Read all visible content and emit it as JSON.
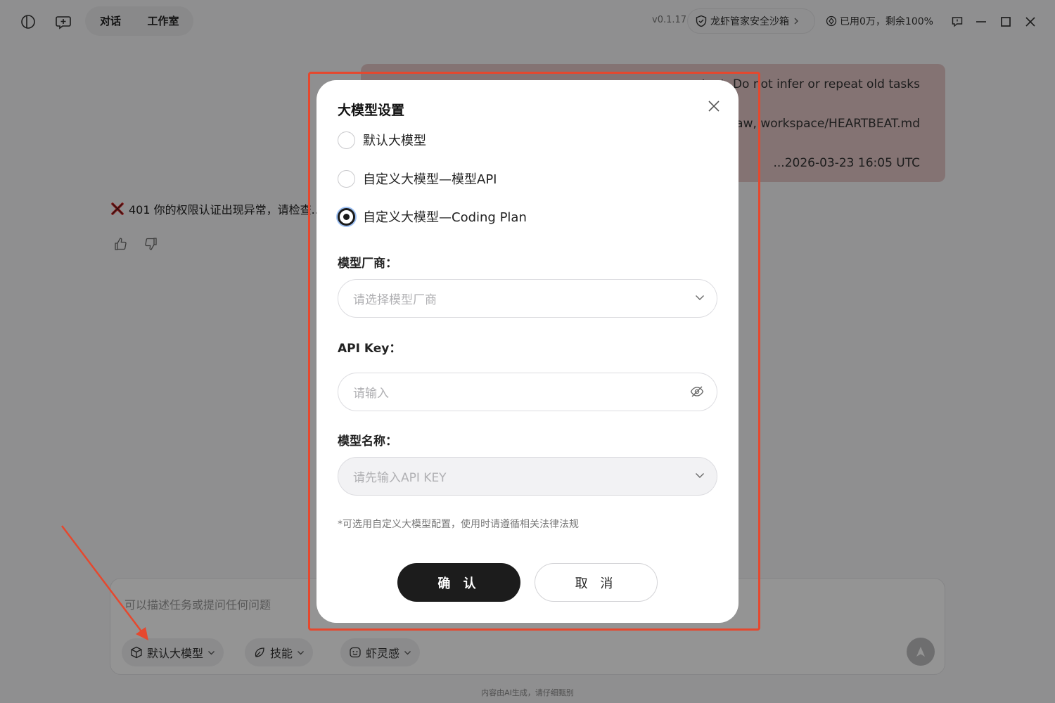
{
  "topbar": {
    "tabs": [
      "对话",
      "工作室"
    ],
    "version": "v0.1.17",
    "sandbox_label": "龙虾管家安全沙箱",
    "quota_label": "已用0万，剩余100%"
  },
  "chat": {
    "user_message": [
      "...ntext. Do not infer or repeat old tasks",
      "...law, workspace/HEARTBEAT.md",
      "...2026-03-23 16:05 UTC"
    ],
    "error_message": "401 你的权限认证出现异常，请检查..."
  },
  "composer": {
    "placeholder": "可以描述任务或提问任何问题",
    "model_chip": "默认大模型",
    "skills_chip": "技能",
    "inspire_chip": "虾灵感"
  },
  "footer": "内容由AI生成，请仔细甄别",
  "dialog": {
    "title": "大模型设置",
    "options": [
      "默认大模型",
      "自定义大模型—模型API",
      "自定义大模型—Coding Plan"
    ],
    "selected_option": "自定义大模型—Coding Plan",
    "vendor_label": "模型厂商：",
    "vendor_placeholder": "请选择模型厂商",
    "apikey_label": "API Key：",
    "apikey_placeholder": "请输入",
    "model_name_label": "模型名称：",
    "model_name_placeholder": "请先输入API KEY",
    "hint": "*可选用自定义大模型配置，使用时请遵循相关法律法规",
    "confirm": "确 认",
    "cancel": "取 消"
  },
  "colors": {
    "highlight_border": "#e5482e",
    "primary_button": "#1c1c1c",
    "user_bubble": "#e3c7c7"
  }
}
